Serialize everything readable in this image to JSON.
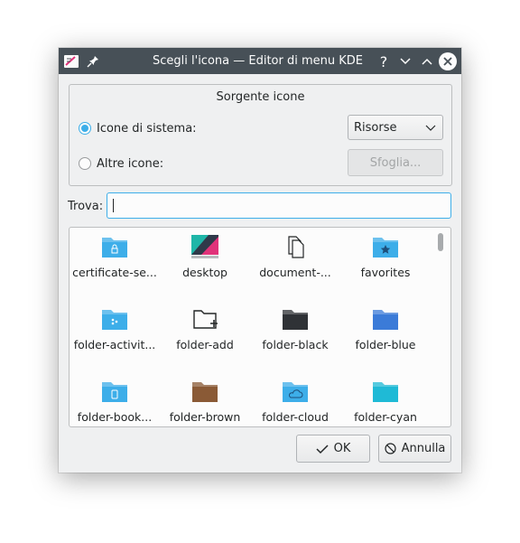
{
  "window": {
    "title": "Scegli l'icona — Editor di menu KDE",
    "help_glyph": "?"
  },
  "source_group": {
    "title": "Sorgente icone",
    "system_icons_label": "Icone di sistema:",
    "other_icons_label": "Altre icone:",
    "system_icons_checked": true,
    "combo_value": "Risorse",
    "browse_label": "Sfoglia..."
  },
  "search": {
    "label": "Trova:",
    "value": ""
  },
  "icons": [
    {
      "label": "certificate-se...",
      "icon": "folder-lock-icon",
      "color": "#3daee9"
    },
    {
      "label": "desktop",
      "icon": "desktop-wallpaper-icon",
      "color": "#e0337a"
    },
    {
      "label": "document-...",
      "icon": "document-multiple-icon",
      "color": "#232627"
    },
    {
      "label": "favorites",
      "icon": "folder-star-icon",
      "color": "#3daee9"
    },
    {
      "label": "folder-activit...",
      "icon": "folder-activities-icon",
      "color": "#3daee9"
    },
    {
      "label": "folder-add",
      "icon": "folder-add-icon",
      "color": "#232627"
    },
    {
      "label": "folder-black",
      "icon": "folder-black-icon",
      "color": "#2f3236"
    },
    {
      "label": "folder-blue",
      "icon": "folder-blue-icon",
      "color": "#3b7bd8"
    },
    {
      "label": "folder-book...",
      "icon": "folder-bookmark-icon",
      "color": "#3daee9"
    },
    {
      "label": "folder-brown",
      "icon": "folder-brown-icon",
      "color": "#8a5a36"
    },
    {
      "label": "folder-cloud",
      "icon": "folder-cloud-icon",
      "color": "#3daee9"
    },
    {
      "label": "folder-cyan",
      "icon": "folder-cyan-icon",
      "color": "#1fbad6"
    }
  ],
  "buttons": {
    "ok_label": "OK",
    "cancel_label": "Annulla"
  },
  "colors": {
    "accent": "#3daee9",
    "titlebar": "#475057"
  }
}
